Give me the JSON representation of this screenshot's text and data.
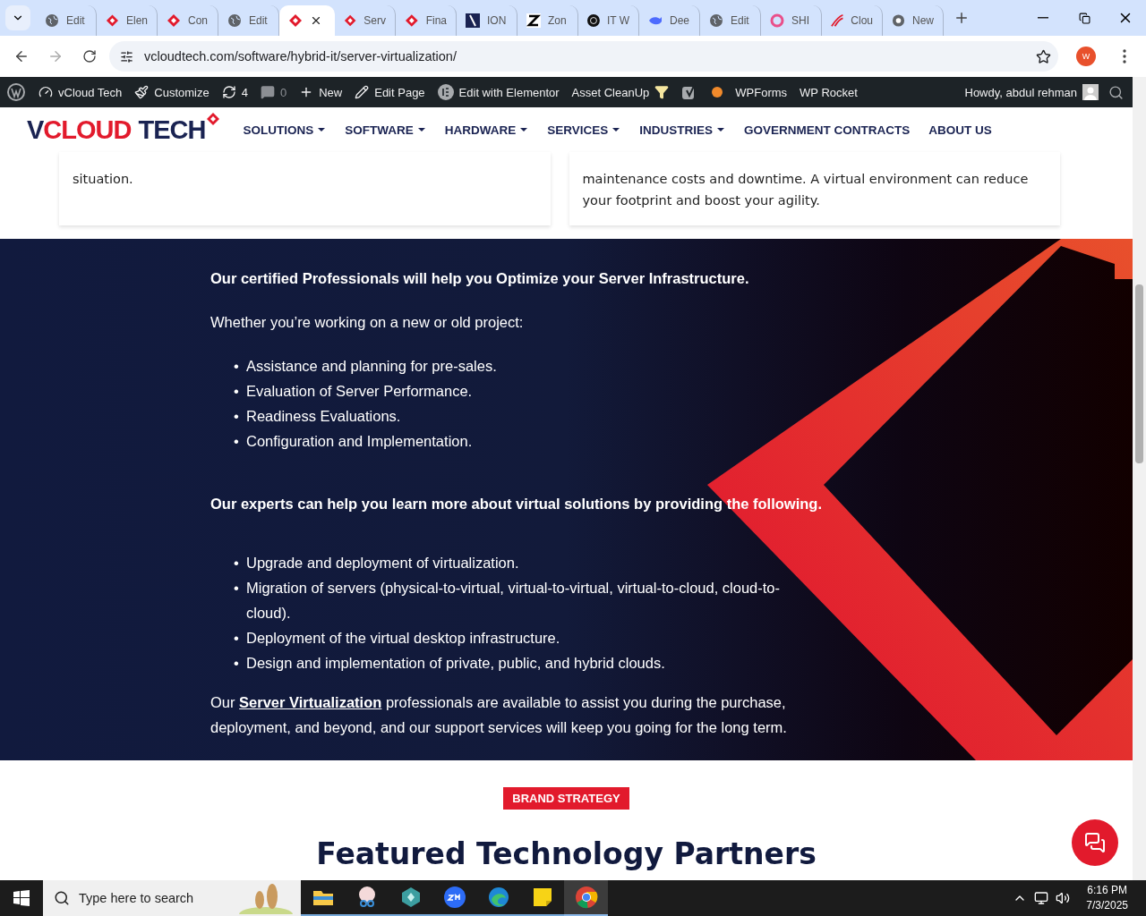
{
  "browser": {
    "tabs": [
      {
        "title": "Edit",
        "kind": "globe",
        "selected": false
      },
      {
        "title": "Elen",
        "kind": "diamond",
        "selected": false
      },
      {
        "title": "Con",
        "kind": "diamond",
        "selected": false
      },
      {
        "title": "Edit",
        "kind": "globe",
        "selected": false
      },
      {
        "kind": "diamond",
        "selected": true
      },
      {
        "title": "Serv",
        "kind": "diamond",
        "selected": false
      },
      {
        "title": "Fina",
        "kind": "diamond",
        "selected": false
      },
      {
        "title": "ION",
        "kind": "slash",
        "selected": false
      },
      {
        "title": "Zon",
        "kind": "z",
        "selected": false
      },
      {
        "title": "IT W",
        "kind": "knot",
        "selected": false
      },
      {
        "title": "Dee",
        "kind": "whale",
        "selected": false
      },
      {
        "title": "Edit",
        "kind": "globe",
        "selected": false
      },
      {
        "title": "SHI",
        "kind": "ring",
        "selected": false
      },
      {
        "title": "Clou",
        "kind": "swoosh",
        "selected": false
      },
      {
        "title": "New",
        "kind": "chrome",
        "selected": false
      }
    ],
    "url": "vcloudtech.com/software/hybrid-it/server-virtualization/",
    "profile": "W"
  },
  "admin_bar": {
    "items": [
      {
        "kind": "site",
        "label": "vCloud Tech"
      },
      {
        "kind": "customize",
        "label": "Customize"
      },
      {
        "kind": "updates",
        "label": "4"
      },
      {
        "kind": "comments",
        "label": "0"
      },
      {
        "kind": "new",
        "label": "New"
      },
      {
        "kind": "edit",
        "label": "Edit Page"
      },
      {
        "kind": "elementor",
        "label": "Edit with Elementor"
      },
      {
        "kind": "cleanup",
        "label": "Asset CleanUp"
      },
      {
        "kind": "seo"
      },
      {
        "kind": "dot"
      },
      {
        "kind": "text",
        "label": "WPForms"
      },
      {
        "kind": "text",
        "label": "WP Rocket"
      }
    ],
    "greeting": "Howdy, abdul rehman"
  },
  "header": {
    "logo_left": "VCLOUD",
    "logo_right": "TECH",
    "nav": [
      {
        "label": "SOLUTIONS",
        "dropdown": true
      },
      {
        "label": "SOFTWARE",
        "dropdown": true
      },
      {
        "label": "HARDWARE",
        "dropdown": true
      },
      {
        "label": "SERVICES",
        "dropdown": true
      },
      {
        "label": "INDUSTRIES",
        "dropdown": true
      },
      {
        "label": "GOVERNMENT CONTRACTS",
        "dropdown": false
      },
      {
        "label": "ABOUT US",
        "dropdown": false
      }
    ]
  },
  "cards": [
    {
      "text": "situation."
    },
    {
      "text": "maintenance costs and downtime. A virtual environment can reduce your footprint and boost your agility."
    }
  ],
  "section": {
    "heading": "Our certified Professionals will help you Optimize your Server Infrastructure.",
    "intro": "Whether you’re working on a new or old project:",
    "list_1": [
      {
        "marker": "•",
        "text": "Assistance and planning for pre-sales."
      },
      {
        "marker": "•",
        "text": "Evaluation of Server Performance."
      },
      {
        "marker": "•",
        "text": "Readiness Evaluations."
      },
      {
        "marker": "•",
        "text": "Configuration and Implementation."
      }
    ],
    "heading_2": "Our experts can help you learn more about virtual solutions by providing the following.",
    "list_2": [
      {
        "marker": "•",
        "text": "Upgrade and deployment of virtualization."
      },
      {
        "marker": "•",
        "text": "Migration of servers (physical-to-virtual, virtual-to-virtual, virtual-to-cloud, cloud-to-cloud)."
      },
      {
        "marker": "•",
        "text": "Deployment of the virtual desktop infrastructure."
      },
      {
        "marker": "•",
        "text": "Design and implementation of private, public, and hybrid clouds."
      }
    ],
    "closing_before": "Our ",
    "closing_link": "Server Virtualization",
    "closing_after": " professionals are available to assist you during the purchase, deployment, and beyond, and our support services will keep you going for the long term."
  },
  "partners": {
    "badge": "BRAND STRATEGY",
    "title": "Featured Technology Partners"
  },
  "taskbar": {
    "search_placeholder": "Type here to search",
    "apps": [
      {
        "kind": "folder",
        "selected": false
      },
      {
        "kind": "snip",
        "selected": false
      },
      {
        "kind": "hex",
        "selected": false
      },
      {
        "kind": "zoom",
        "selected": false
      },
      {
        "kind": "edge",
        "selected": false
      },
      {
        "kind": "notes",
        "selected": false
      },
      {
        "kind": "chrome",
        "selected": true
      }
    ],
    "time": "6:16 PM",
    "date": "7/3/2025"
  }
}
